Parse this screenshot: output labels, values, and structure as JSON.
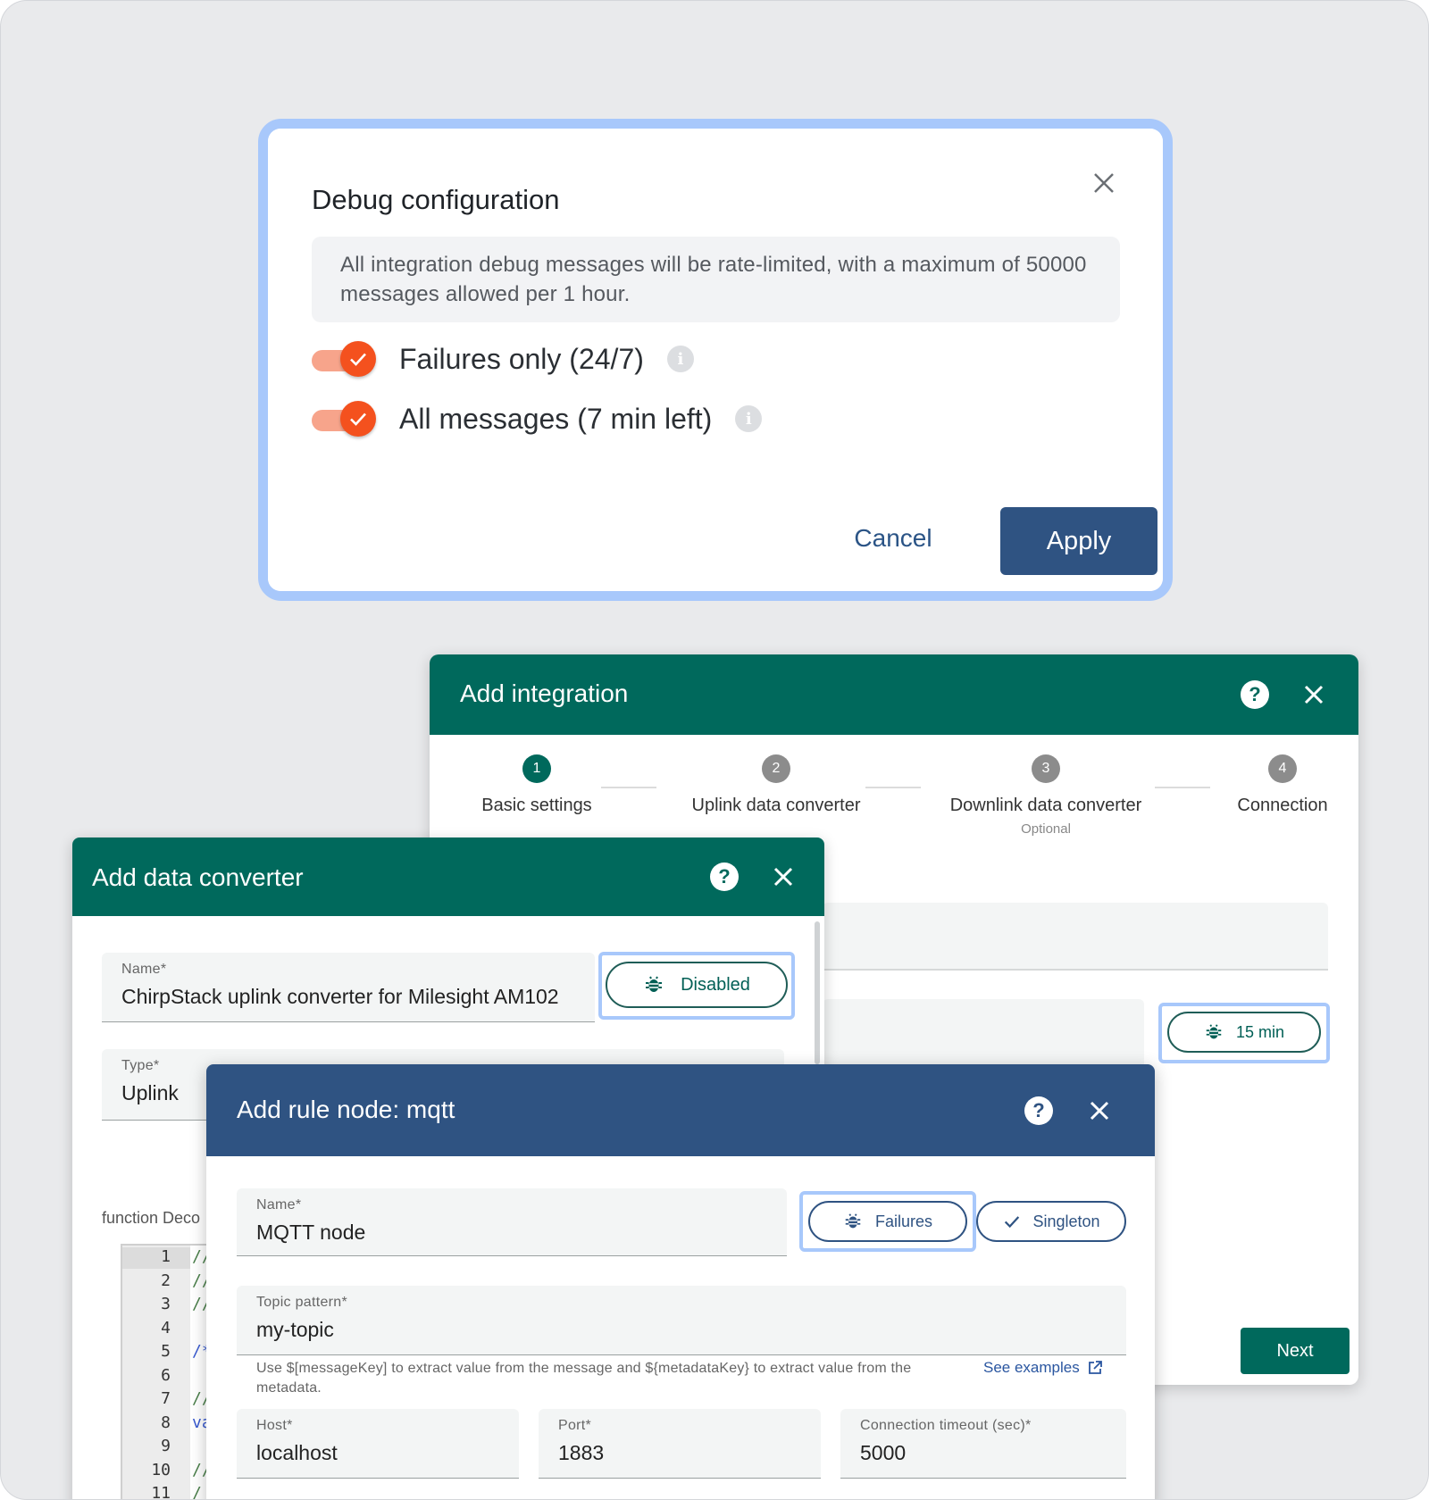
{
  "debug_dialog": {
    "title": "Debug configuration",
    "note": "All integration debug messages will be rate-limited, with a maximum of 50000 messages allowed per 1 hour.",
    "options": [
      {
        "label": "Failures only (24/7)",
        "checked": true
      },
      {
        "label": "All messages (7 min left)",
        "checked": true
      }
    ],
    "cancel_label": "Cancel",
    "apply_label": "Apply"
  },
  "integration_dialog": {
    "title": "Add integration",
    "steps": [
      {
        "number": "1",
        "label": "Basic settings",
        "sub": "",
        "active": true
      },
      {
        "number": "2",
        "label": "Uplink data converter",
        "sub": "",
        "active": false
      },
      {
        "number": "3",
        "label": "Downlink data converter",
        "sub": "Optional",
        "active": false
      },
      {
        "number": "4",
        "label": "Connection",
        "sub": "",
        "active": false
      }
    ],
    "debug_button_label": "15 min",
    "next_label": "Next"
  },
  "converter_dialog": {
    "title": "Add data converter",
    "name_field": {
      "label": "Name*",
      "value": "ChirpStack uplink converter for Milesight AM102"
    },
    "debug_button_label": "Disabled",
    "type_field": {
      "label": "Type*",
      "value": "Uplink"
    },
    "function_label": "function Deco",
    "line_numbers": [
      "1",
      "2",
      "3",
      "4",
      "5",
      "6",
      "7",
      "8",
      "9",
      "10",
      "11"
    ],
    "code_lines": [
      "//",
      "//",
      "//",
      "",
      "/*",
      "",
      "//",
      "va",
      "",
      "//",
      "/"
    ]
  },
  "rule_dialog": {
    "title": "Add rule node: mqtt",
    "name_field": {
      "label": "Name*",
      "value": "MQTT node"
    },
    "failures_label": "Failures",
    "singleton_label": "Singleton",
    "topic_field": {
      "label": "Topic pattern*",
      "value": "my-topic"
    },
    "hint": "Use $[messageKey] to extract value from the message and ${metadataKey} to extract value from the metadata.",
    "see_examples_label": "See examples",
    "host_field": {
      "label": "Host*",
      "value": "localhost"
    },
    "port_field": {
      "label": "Port*",
      "value": "1883"
    },
    "timeout_field": {
      "label": "Connection timeout (sec)*",
      "value": "5000"
    }
  },
  "colors": {
    "accent_orange": "#f4511e",
    "teal": "#00695c",
    "navy": "#2f5382",
    "highlight_blue": "#a8c8fb"
  }
}
